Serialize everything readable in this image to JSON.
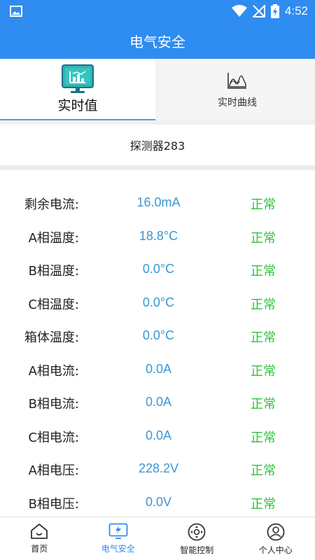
{
  "status_bar": {
    "time": "4:52"
  },
  "app_bar": {
    "title": "电气安全"
  },
  "tabs": [
    {
      "label": "实时值",
      "icon": "monitor-chart-icon",
      "active": true
    },
    {
      "label": "实时曲线",
      "icon": "area-curve-icon",
      "active": false
    }
  ],
  "detector": {
    "name": "探测器283"
  },
  "readings": [
    {
      "label": "剩余电流:",
      "value": "16.0mA",
      "status": "正常"
    },
    {
      "label": "A相温度:",
      "value": "18.8°C",
      "status": "正常"
    },
    {
      "label": "B相温度:",
      "value": "0.0°C",
      "status": "正常"
    },
    {
      "label": "C相温度:",
      "value": "0.0°C",
      "status": "正常"
    },
    {
      "label": "箱体温度:",
      "value": "0.0°C",
      "status": "正常"
    },
    {
      "label": "A相电流:",
      "value": "0.0A",
      "status": "正常"
    },
    {
      "label": "B相电流:",
      "value": "0.0A",
      "status": "正常"
    },
    {
      "label": "C相电流:",
      "value": "0.0A",
      "status": "正常"
    },
    {
      "label": "A相电压:",
      "value": "228.2V",
      "status": "正常"
    },
    {
      "label": "B相电压:",
      "value": "0.0V",
      "status": "正常"
    }
  ],
  "bottom_nav": [
    {
      "label": "首页",
      "icon": "home-icon",
      "active": false
    },
    {
      "label": "电气安全",
      "icon": "electric-safety-icon",
      "active": true
    },
    {
      "label": "智能控制",
      "icon": "smart-control-icon",
      "active": false
    },
    {
      "label": "个人中心",
      "icon": "profile-icon",
      "active": false
    }
  ],
  "colors": {
    "primary": "#2f8cf0",
    "value": "#3a97d4",
    "status_ok": "#2ec23a"
  }
}
